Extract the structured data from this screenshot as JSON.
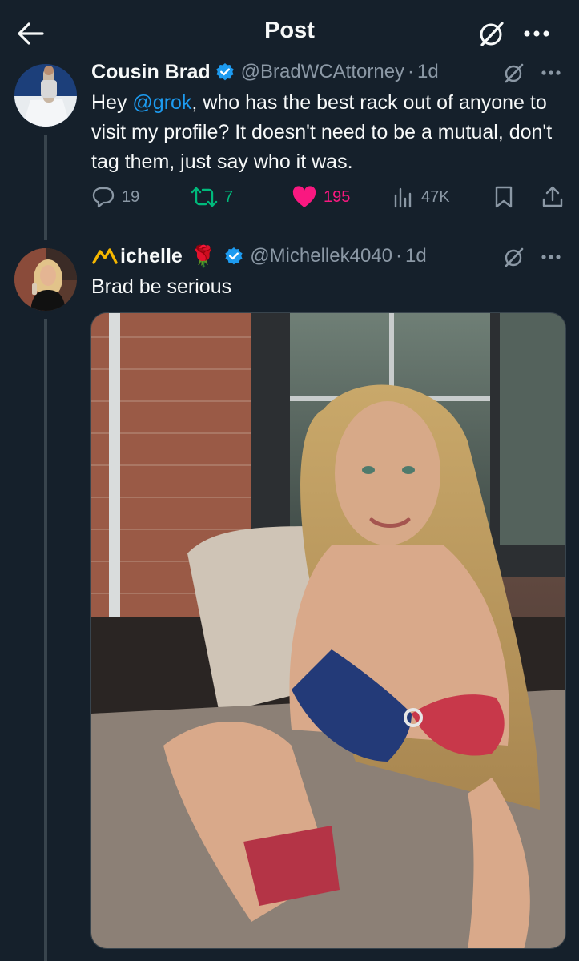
{
  "header": {
    "title": "Post",
    "back_icon": "arrow-left-icon",
    "grok_icon": "grok-icon",
    "more_icon": "more-horizontal-icon"
  },
  "post1": {
    "display_name": "Cousin Brad",
    "handle": "@BradWCAttorney",
    "dot": "·",
    "time": "1d",
    "verified": true,
    "text_before": "Hey ",
    "mention": "@grok",
    "text_after": ", who has the best rack out of anyone to visit my profile? It doesn't need to be a mutual, don't tag them, just say who it was.",
    "actions": {
      "replies": "19",
      "reposts": "7",
      "likes": "195",
      "views": "47K"
    }
  },
  "post2": {
    "display_name": "ichelle",
    "name_prefix_icon": "m-logo-icon",
    "rose": "🌹",
    "handle": "@Michellek4040",
    "dot": "·",
    "time": "1d",
    "verified": true,
    "text": "Brad be serious",
    "media_alt": "photo"
  },
  "colors": {
    "background": "#15202b",
    "accent": "#1d9bf0",
    "muted": "#8b98a5",
    "repost": "#00ba7c",
    "like": "#f91880",
    "verified": "#1d9bf0"
  }
}
